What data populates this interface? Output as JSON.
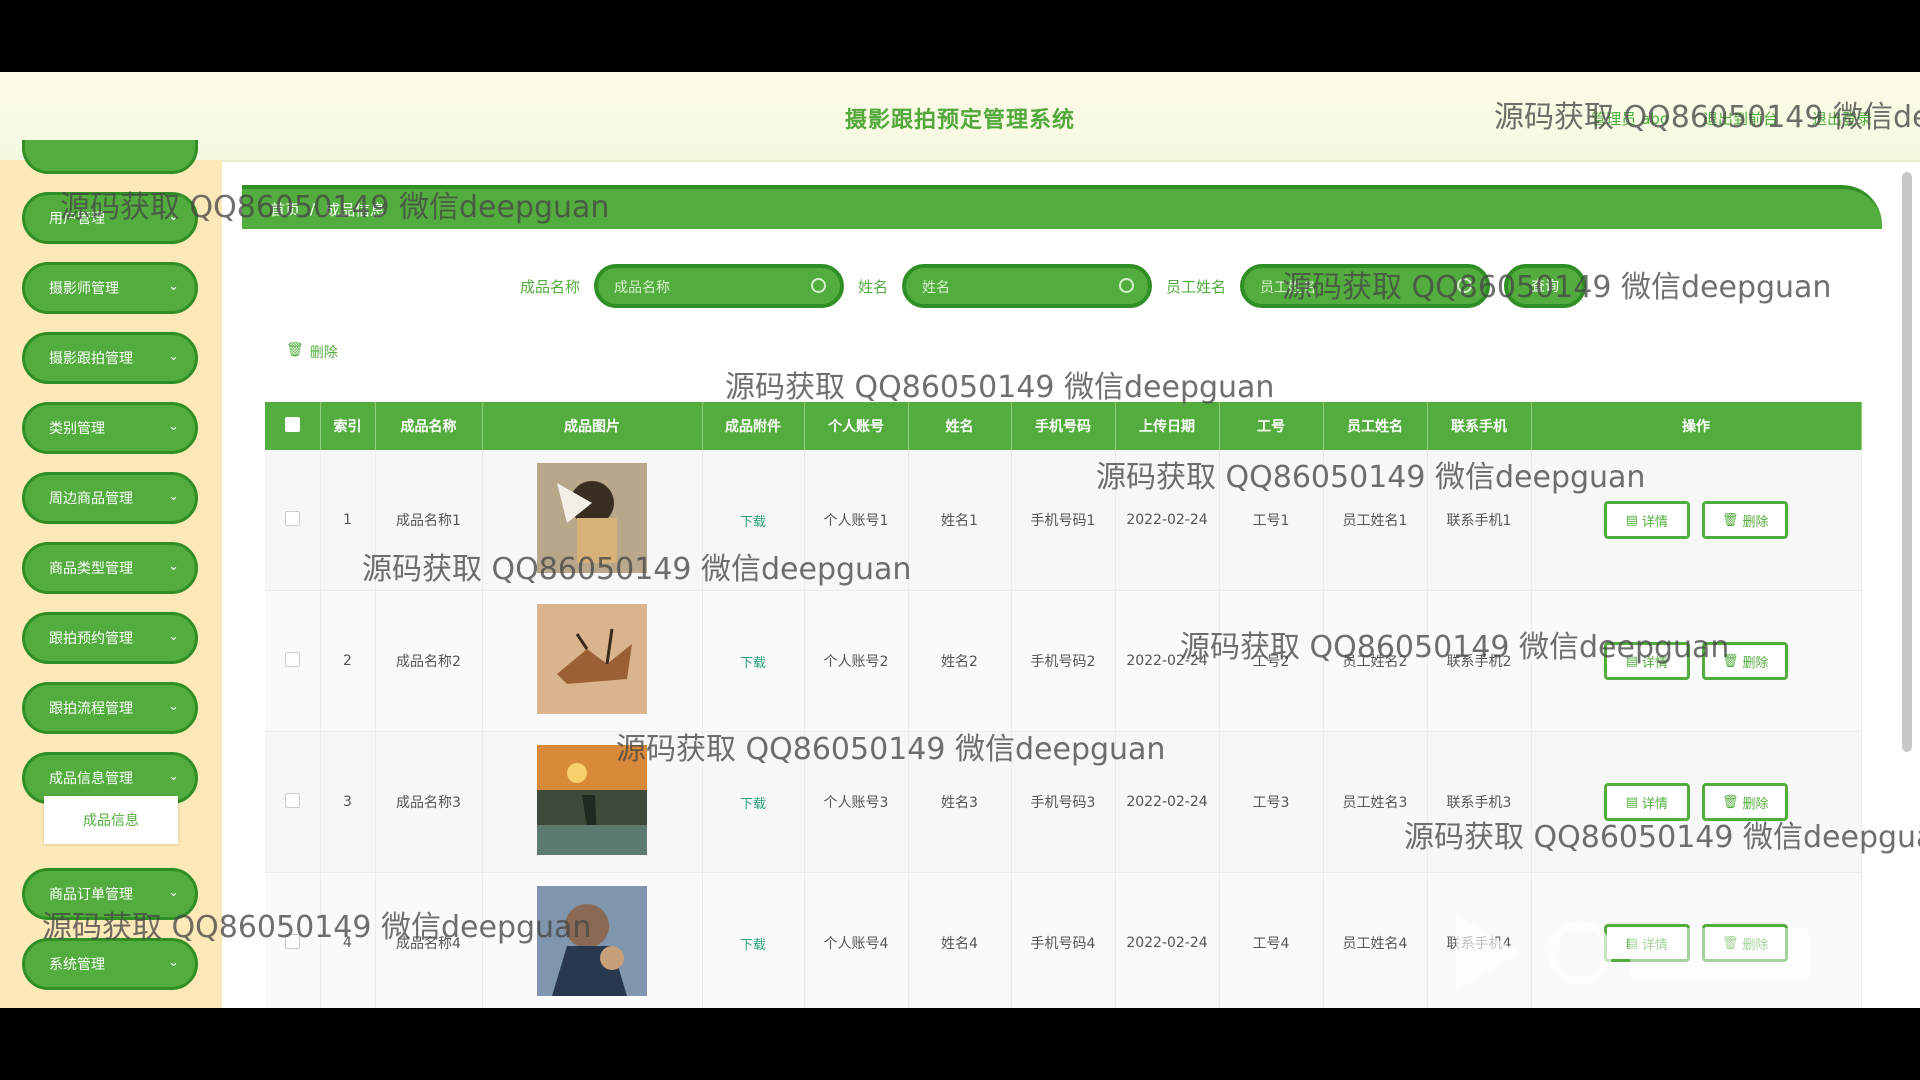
{
  "app": {
    "title": "摄影跟拍预定管理系统"
  },
  "header": {
    "links": [
      "管理员 abo",
      "退出到前台",
      "退出登录"
    ]
  },
  "sidebar": {
    "items": [
      {
        "label": "用户管理"
      },
      {
        "label": "摄影师管理"
      },
      {
        "label": "摄影跟拍管理"
      },
      {
        "label": "类别管理"
      },
      {
        "label": "周边商品管理"
      },
      {
        "label": "商品类型管理"
      },
      {
        "label": "跟拍预约管理"
      },
      {
        "label": "跟拍流程管理"
      },
      {
        "label": "成品信息管理"
      },
      {
        "label": "商品订单管理"
      },
      {
        "label": "系统管理"
      }
    ],
    "active_sub": "成品信息"
  },
  "breadcrumb": {
    "home": "首页",
    "sep": "/",
    "current": "成品信息"
  },
  "search": {
    "name_label": "成品名称",
    "name_placeholder": "成品名称",
    "xm_label": "姓名",
    "xm_placeholder": "姓名",
    "staff_label": "员工姓名",
    "staff_placeholder": "员工姓名",
    "button": "查询"
  },
  "toolbar": {
    "delete_label": "删除"
  },
  "table": {
    "headers": [
      "索引",
      "成品名称",
      "成品图片",
      "成品附件",
      "个人账号",
      "姓名",
      "手机号码",
      "上传日期",
      "工号",
      "员工姓名",
      "联系手机",
      "操作"
    ],
    "download_label": "下载",
    "detail_label": "详情",
    "delete_label": "删除",
    "rows": [
      {
        "idx": "1",
        "name": "成品名称1",
        "account": "个人账号1",
        "xm": "姓名1",
        "phone": "手机号码1",
        "date": "2022-02-24",
        "gh": "工号1",
        "staff": "员工姓名1",
        "mobile": "联系手机1"
      },
      {
        "idx": "2",
        "name": "成品名称2",
        "account": "个人账号2",
        "xm": "姓名2",
        "phone": "手机号码2",
        "date": "2022-02-24",
        "gh": "工号2",
        "staff": "员工姓名2",
        "mobile": "联系手机2"
      },
      {
        "idx": "3",
        "name": "成品名称3",
        "account": "个人账号3",
        "xm": "姓名3",
        "phone": "手机号码3",
        "date": "2022-02-24",
        "gh": "工号3",
        "staff": "员工姓名3",
        "mobile": "联系手机3"
      },
      {
        "idx": "4",
        "name": "成品名称4",
        "account": "个人账号4",
        "xm": "姓名4",
        "phone": "手机号码4",
        "date": "2022-02-24",
        "gh": "工号4",
        "staff": "员工姓名4",
        "mobile": "联系手机4"
      }
    ]
  },
  "watermark": {
    "text": "源码获取 QQ86050149 微信deepguan"
  },
  "colors": {
    "primary": "#53ad3e",
    "primary_border": "#2f8e24",
    "sidebar_bg": "#fde9b8"
  }
}
